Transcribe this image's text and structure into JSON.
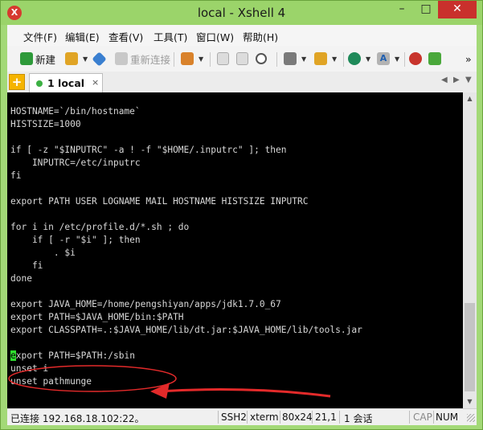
{
  "window": {
    "title": "local - Xshell 4",
    "app_icon": "xshell-logo",
    "minimize_label": "–",
    "maximize_label": "□",
    "close_label": "✕"
  },
  "menu": {
    "items": [
      {
        "label": "文件(F)"
      },
      {
        "label": "编辑(E)"
      },
      {
        "label": "查看(V)"
      },
      {
        "label": "工具(T)"
      },
      {
        "label": "窗口(W)"
      },
      {
        "label": "帮助(H)"
      }
    ]
  },
  "toolbar": {
    "new_label": "新建",
    "reconnect_label": "重新连接",
    "overflow_label": "»",
    "icons": [
      "new-session-icon",
      "open-folder-icon",
      "connect-icon",
      "reconnect-icon",
      "properties-icon",
      "copy-icon",
      "paste-icon",
      "find-icon",
      "print-icon",
      "transfer-icon",
      "globe-icon",
      "font-icon",
      "xftp-icon",
      "script-icon"
    ],
    "colors": {
      "new": "#2e9a3a",
      "folder": "#e0a425",
      "connect": "#3a7fd0",
      "props": "#d9822b",
      "globe": "#1f8a5a",
      "xftp": "#c8342c"
    }
  },
  "tabs": {
    "add_label": "+",
    "items": [
      {
        "label": "1 local",
        "status": "connected"
      }
    ],
    "close_label": "×",
    "nav_prev": "◀",
    "nav_next": "▶",
    "nav_menu": "▼"
  },
  "terminal": {
    "lines_before_cursor": "HOSTNAME=`/bin/hostname`\nHISTSIZE=1000\n\nif [ -z \"$INPUTRC\" -a ! -f \"$HOME/.inputrc\" ]; then\n    INPUTRC=/etc/inputrc\nfi\n\nexport PATH USER LOGNAME MAIL HOSTNAME HISTSIZE INPUTRC\n\nfor i in /etc/profile.d/*.sh ; do\n    if [ -r \"$i\" ]; then\n        . $i\n    fi\ndone\n\nexport JAVA_HOME=/home/pengshiyan/apps/jdk1.7.0_67\nexport PATH=$JAVA_HOME/bin:$PATH\nexport CLASSPATH=.:$JAVA_HOME/lib/dt.jar:$JAVA_HOME/lib/tools.jar\n\n",
    "cursor_char": "e",
    "lines_after_cursor": "xport PATH=$PATH:/sbin\nunset i\nunset pathmunge",
    "annotation_color": "#e32a2a",
    "cursor_color": "#2fdc2f"
  },
  "statusbar": {
    "connection": "已连接 192.168.18.102:22。",
    "protocol": "SSH2",
    "terminal_type": "xterm",
    "size": "80x24",
    "cursor_pos": "21,1",
    "sessions": "1 会话",
    "caps": "CAP",
    "num": "NUM"
  }
}
